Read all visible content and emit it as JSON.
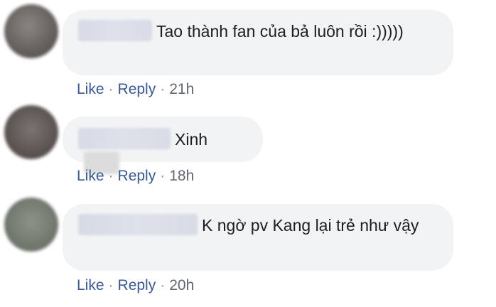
{
  "comments": [
    {
      "text": "Tao thành fan của bả luôn rồi :)))))",
      "actions": {
        "like": "Like",
        "sep1": "·",
        "reply": "Reply",
        "sep2": "·",
        "time": "21h"
      },
      "avatar_color": "#6f6a66"
    },
    {
      "text": "Xinh",
      "actions": {
        "like": "Like",
        "sep1": "·",
        "reply": "Reply",
        "sep2": "·",
        "time": "18h"
      },
      "avatar_color": "#5f5856"
    },
    {
      "text": "K ngờ pv Kang lại trẻ như vậy",
      "actions": {
        "like": "Like",
        "sep1": "·",
        "reply": "Reply",
        "sep2": "·",
        "time": "20h"
      },
      "avatar_color": "#7a8278"
    }
  ],
  "colors": {
    "link": "#385898",
    "bubble_bg": "#f2f3f5",
    "time": "#616770"
  }
}
